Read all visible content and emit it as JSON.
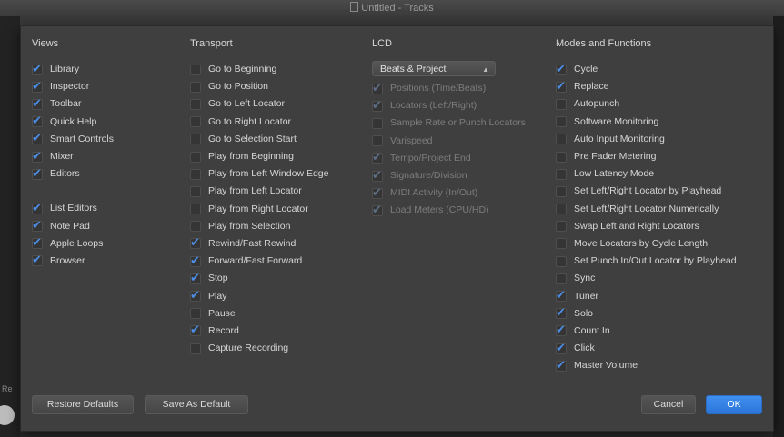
{
  "window": {
    "title": "Untitled - Tracks"
  },
  "background": {
    "tiny_label": "Re"
  },
  "views": {
    "heading": "Views",
    "items": [
      {
        "label": "Library",
        "checked": true
      },
      {
        "label": "Inspector",
        "checked": true
      },
      {
        "label": "Toolbar",
        "checked": true
      },
      {
        "label": "Quick Help",
        "checked": true
      },
      {
        "label": "Smart Controls",
        "checked": true
      },
      {
        "label": "Mixer",
        "checked": true
      },
      {
        "label": "Editors",
        "checked": true
      },
      {
        "label": "List Editors",
        "checked": true
      },
      {
        "label": "Note Pad",
        "checked": true
      },
      {
        "label": "Apple Loops",
        "checked": true
      },
      {
        "label": "Browser",
        "checked": true
      }
    ]
  },
  "transport": {
    "heading": "Transport",
    "items": [
      {
        "label": "Go to Beginning",
        "checked": false
      },
      {
        "label": "Go to Position",
        "checked": false
      },
      {
        "label": "Go to Left Locator",
        "checked": false
      },
      {
        "label": "Go to Right Locator",
        "checked": false
      },
      {
        "label": "Go to Selection Start",
        "checked": false
      },
      {
        "label": "Play from Beginning",
        "checked": false
      },
      {
        "label": "Play from Left Window Edge",
        "checked": false
      },
      {
        "label": "Play from Left Locator",
        "checked": false
      },
      {
        "label": "Play from Right Locator",
        "checked": false
      },
      {
        "label": "Play from Selection",
        "checked": false
      },
      {
        "label": "Rewind/Fast Rewind",
        "checked": true
      },
      {
        "label": "Forward/Fast Forward",
        "checked": true
      },
      {
        "label": "Stop",
        "checked": true
      },
      {
        "label": "Play",
        "checked": true
      },
      {
        "label": "Pause",
        "checked": false
      },
      {
        "label": "Record",
        "checked": true
      },
      {
        "label": "Capture Recording",
        "checked": false
      }
    ]
  },
  "lcd": {
    "heading": "LCD",
    "mode_popup": "Beats & Project",
    "items": [
      {
        "label": "Positions (Time/Beats)",
        "checked": true
      },
      {
        "label": "Locators (Left/Right)",
        "checked": true
      },
      {
        "label": "Sample Rate or Punch Locators",
        "checked": false
      },
      {
        "label": "Varispeed",
        "checked": false
      },
      {
        "label": "Tempo/Project End",
        "checked": true
      },
      {
        "label": "Signature/Division",
        "checked": true
      },
      {
        "label": "MIDI Activity (In/Out)",
        "checked": true
      },
      {
        "label": "Load Meters (CPU/HD)",
        "checked": true
      }
    ]
  },
  "modes": {
    "heading": "Modes and Functions",
    "items": [
      {
        "label": "Cycle",
        "checked": true
      },
      {
        "label": "Replace",
        "checked": true
      },
      {
        "label": "Autopunch",
        "checked": false
      },
      {
        "label": "Software Monitoring",
        "checked": false
      },
      {
        "label": "Auto Input Monitoring",
        "checked": false
      },
      {
        "label": "Pre Fader Metering",
        "checked": false
      },
      {
        "label": "Low Latency Mode",
        "checked": false
      },
      {
        "label": "Set Left/Right Locator by Playhead",
        "checked": false
      },
      {
        "label": "Set Left/Right Locator Numerically",
        "checked": false
      },
      {
        "label": "Swap Left and Right Locators",
        "checked": false
      },
      {
        "label": "Move Locators by Cycle Length",
        "checked": false
      },
      {
        "label": "Set Punch In/Out Locator by Playhead",
        "checked": false
      },
      {
        "label": "Sync",
        "checked": false
      },
      {
        "label": "Tuner",
        "checked": true
      },
      {
        "label": "Solo",
        "checked": true
      },
      {
        "label": "Count In",
        "checked": true
      },
      {
        "label": "Click",
        "checked": true
      },
      {
        "label": "Master Volume",
        "checked": true
      }
    ]
  },
  "buttons": {
    "restore_defaults": "Restore Defaults",
    "save_as_default": "Save As Default",
    "cancel": "Cancel",
    "ok": "OK"
  },
  "colors": {
    "accent": "#3f8ff0",
    "check": "#4c8de6"
  }
}
